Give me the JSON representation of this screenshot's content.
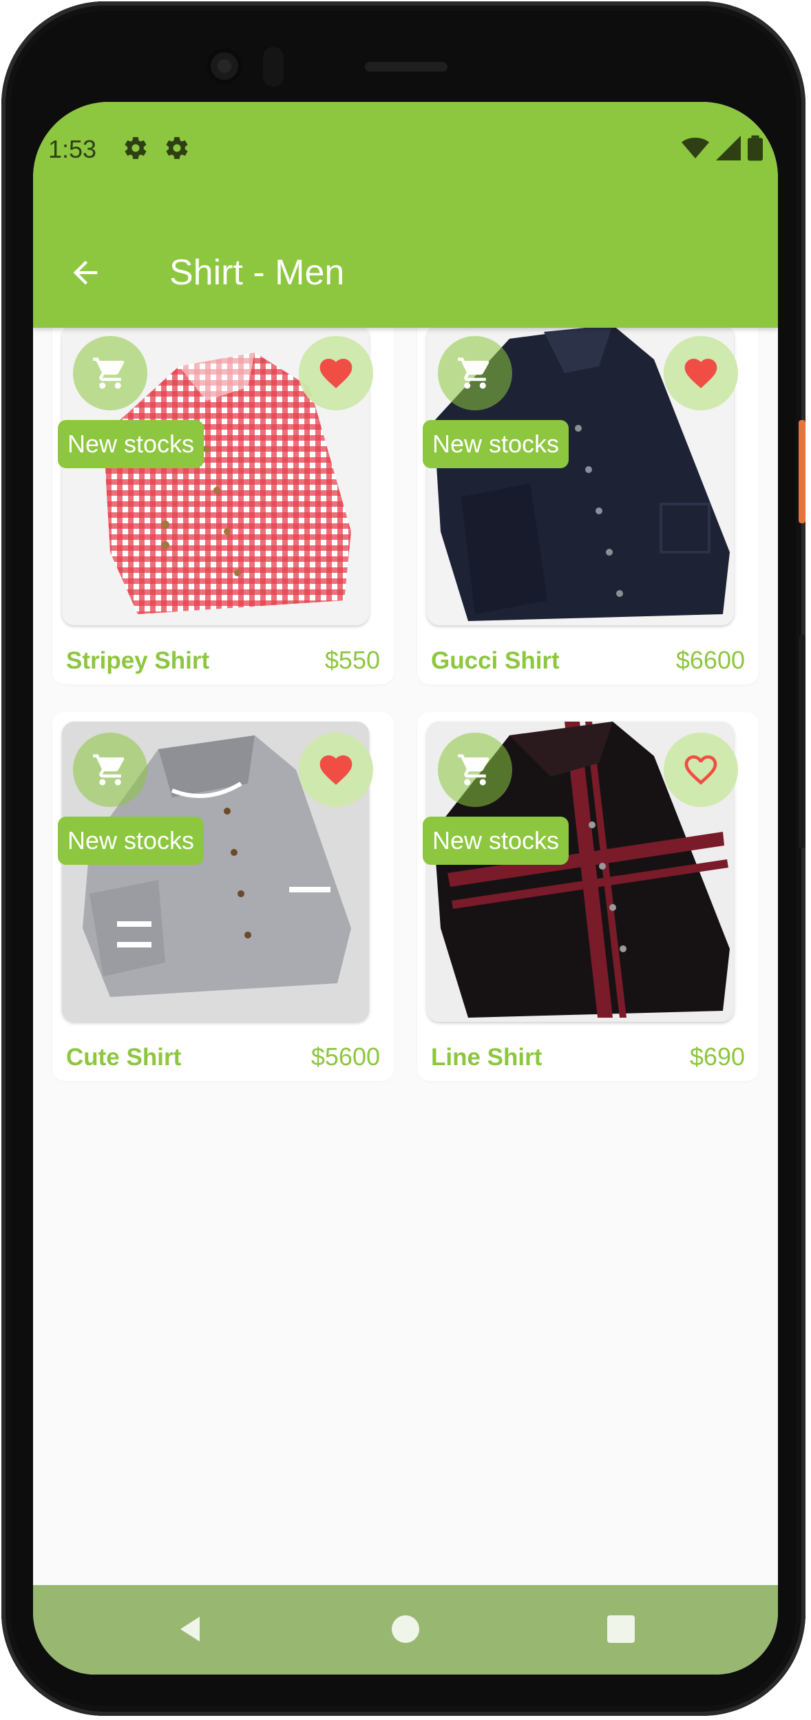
{
  "status_bar": {
    "time": "1:53"
  },
  "app_bar": {
    "title": "Shirt - Men"
  },
  "colors": {
    "primary": "#8dc63f",
    "favorite": "#f04e45",
    "nav_bar": "#98b872"
  },
  "products": [
    {
      "name": "Stripey Shirt",
      "price": "$550",
      "badge": "New stocks",
      "favorite": true,
      "image": "red-gingham-shirt"
    },
    {
      "name": "Gucci Shirt",
      "price": "$6600",
      "badge": "New stocks",
      "favorite": true,
      "image": "navy-shirt"
    },
    {
      "name": "Cute Shirt",
      "price": "$5600",
      "badge": "New stocks",
      "favorite": true,
      "image": "grey-mandarin-shirt"
    },
    {
      "name": "Line Shirt",
      "price": "$690",
      "badge": "New stocks",
      "favorite": false,
      "image": "black-red-stripe-shirt"
    }
  ],
  "icons": {
    "back": "arrow-left-icon",
    "cart": "shopping-cart-icon",
    "favorite": "heart-icon",
    "settings": "gear-icon",
    "wifi": "wifi-icon",
    "signal": "signal-icon",
    "battery": "battery-icon"
  }
}
